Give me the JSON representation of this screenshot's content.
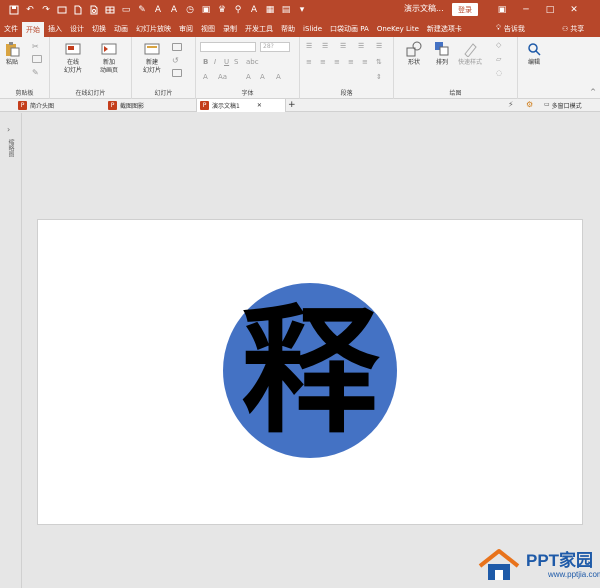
{
  "titlebar": {
    "doc_title": "演示文稿...",
    "login_label": "登录",
    "qat_icons": [
      "save-icon",
      "undo-icon",
      "redo-icon",
      "start-icon",
      "new-icon",
      "print-icon",
      "table-icon",
      "shape-icon",
      "picture-icon"
    ]
  },
  "tabs": [
    "文件",
    "开始",
    "插入",
    "设计",
    "切换",
    "动画",
    "幻灯片放映",
    "审阅",
    "视图",
    "录制",
    "开发工具",
    "帮助",
    "iSlide",
    "口袋动画 PA",
    "OneKey Lite",
    "新建选项卡"
  ],
  "active_tab": "开始",
  "tell_me": "告诉我",
  "share": "共享",
  "ribbon": {
    "groups": {
      "clipboard": {
        "label": "剪贴板",
        "paste": "粘贴"
      },
      "online_slides": {
        "label": "在线幻灯片",
        "online": "在线\n幻灯片",
        "add_animation": "新加\n动画页"
      },
      "slides": {
        "label": "幻灯片",
        "new_slide": "新建\n幻灯片"
      },
      "font": {
        "label": "字体",
        "font_size": "28?"
      },
      "paragraph": {
        "label": "段落"
      },
      "drawing": {
        "label": "绘图",
        "shapes": "形状",
        "arrange": "排列",
        "quick_styles": "快速样式"
      },
      "editing": {
        "label": "编辑"
      }
    }
  },
  "doc_tabs": {
    "tabs": [
      "简介头图",
      "截图图影",
      "演示文稿1"
    ],
    "active": "演示文稿1",
    "multi_window": "多窗口模式"
  },
  "leftpane": {
    "label": "缩略图"
  },
  "slide": {
    "glyph": "释",
    "circle_color": "#4472c4"
  },
  "watermark": {
    "title": "PPT家园",
    "url": "www.pptjia.com"
  }
}
